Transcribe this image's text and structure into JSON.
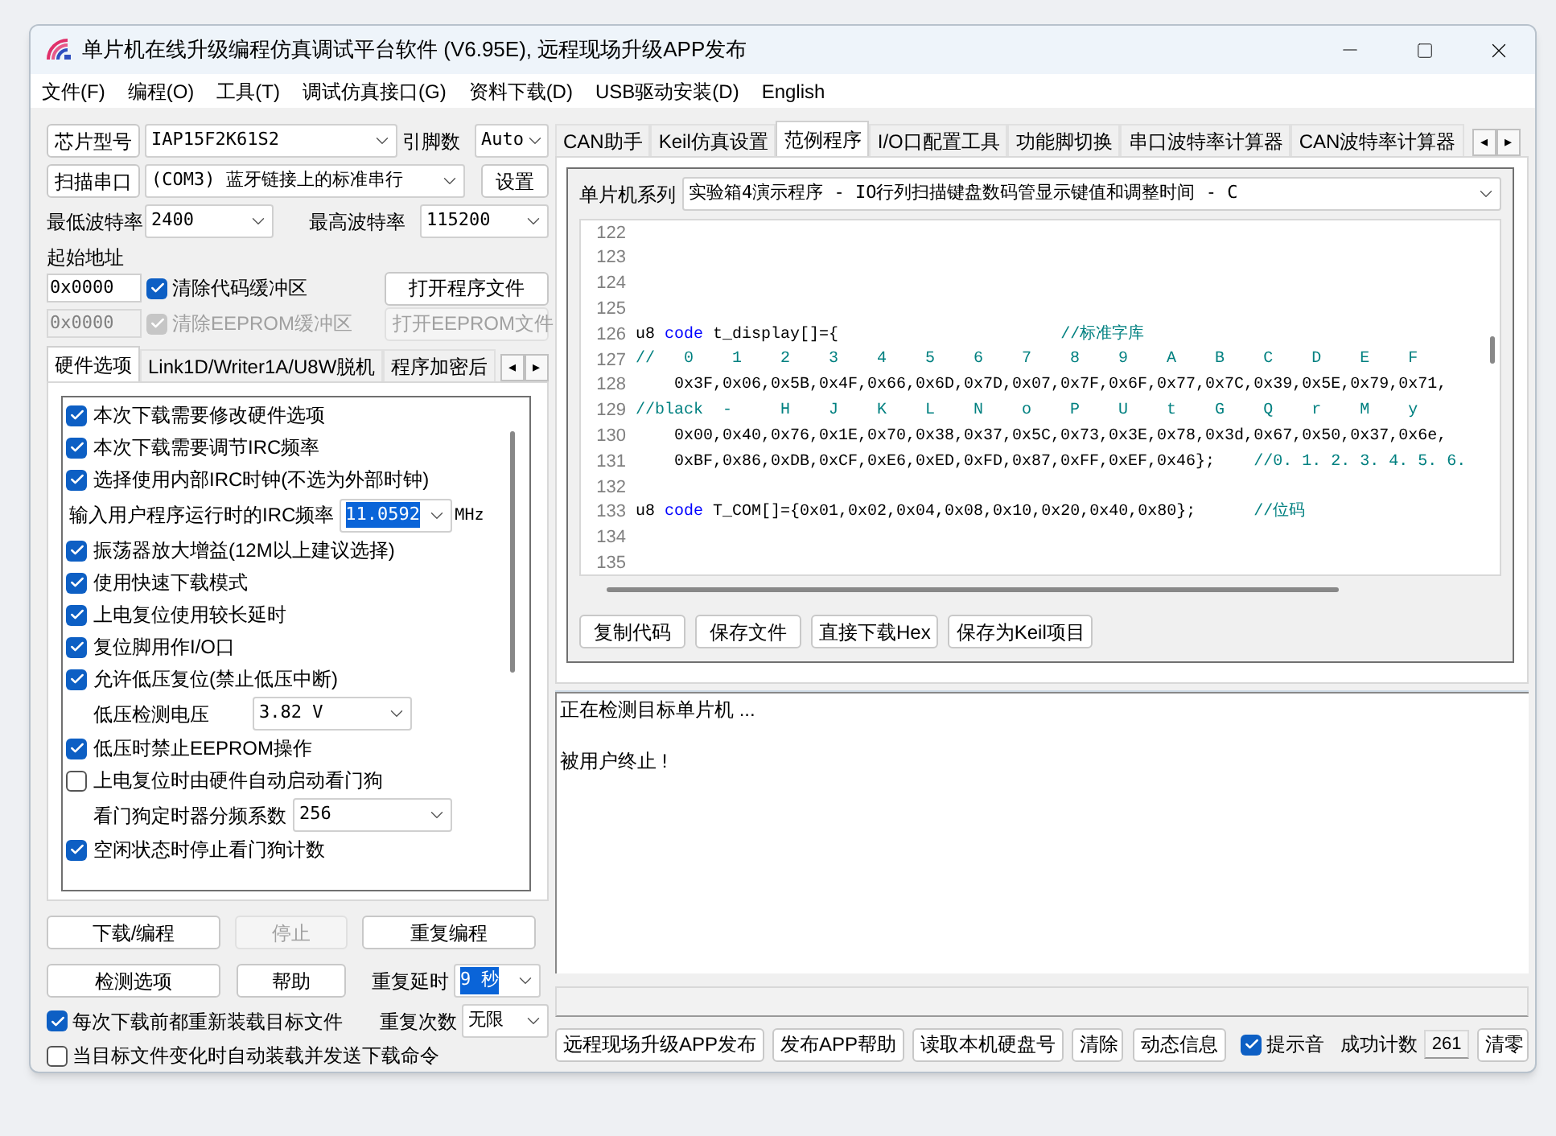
{
  "window": {
    "title": "单片机在线升级编程仿真调试平台软件 (V6.95E), 远程现场升级APP发布"
  },
  "menu": [
    "文件(F)",
    "编程(O)",
    "工具(T)",
    "调试仿真接口(G)",
    "资料下载(D)",
    "USB驱动安装(D)",
    "English"
  ],
  "chip": {
    "button": "芯片型号",
    "model": "IAP15F2K61S2",
    "pins_label": "引脚数",
    "pins": "Auto"
  },
  "port": {
    "button": "扫描串口",
    "value": "(COM3) 蓝牙链接上的标准串行",
    "settings": "设置"
  },
  "baud": {
    "min_label": "最低波特率",
    "min": "2400",
    "max_label": "最高波特率",
    "max": "115200"
  },
  "start_address": {
    "label": "起始地址",
    "value": "0x0000",
    "clear": {
      "label": "清除代码缓冲区",
      "checked": true
    },
    "open_file": "打开程序文件"
  },
  "eeprom": {
    "value": "0x0000",
    "disabled": true,
    "clear": {
      "label": "清除EEPROM缓冲区",
      "checked": true
    },
    "open_file": "打开EEPROM文件"
  },
  "left_tabs": [
    {
      "label": "硬件选项",
      "selected": true
    },
    {
      "label": "Link1D/Writer1A/U8W脱机",
      "selected": false
    },
    {
      "label": "程序加密后",
      "selected": false
    }
  ],
  "left_tab_scroll": [
    "◂",
    "▸"
  ],
  "options": [
    {
      "kind": "checkbox",
      "label": "本次下载需要修改硬件选项",
      "checked": true
    },
    {
      "kind": "checkbox",
      "label": "本次下载需要调节IRC频率",
      "checked": true
    },
    {
      "kind": "checkbox",
      "label": "选择使用内部IRC时钟(不选为外部时钟)",
      "checked": true
    },
    {
      "kind": "input",
      "label": "输入用户程序运行时的IRC频率",
      "value": "11.0592",
      "unit": "MHz"
    },
    {
      "kind": "checkbox",
      "label": "振荡器放大增益(12M以上建议选择)",
      "checked": true
    },
    {
      "kind": "checkbox",
      "label": "使用快速下载模式",
      "checked": true
    },
    {
      "kind": "checkbox",
      "label": "上电复位使用较长延时",
      "checked": true
    },
    {
      "kind": "checkbox",
      "label": "复位脚用作I/O口",
      "checked": true
    },
    {
      "kind": "checkbox",
      "label": "允许低压复位(禁止低压中断)",
      "checked": true
    },
    {
      "kind": "select",
      "label": "低压检测电压",
      "value": "3.82 V"
    },
    {
      "kind": "checkbox",
      "label": "低压时禁止EEPROM操作",
      "checked": true
    },
    {
      "kind": "checkbox",
      "label": "上电复位时由硬件自动启动看门狗",
      "checked": false
    },
    {
      "kind": "select",
      "label": "看门狗定时器分频系数",
      "value": "256"
    },
    {
      "kind": "checkbox",
      "label": "空闲状态时停止看门狗计数",
      "checked": true
    }
  ],
  "program_buttons": [
    {
      "label": "下载/编程",
      "disabled": false
    },
    {
      "label": "停止",
      "disabled": true
    },
    {
      "label": "重复编程",
      "disabled": false
    },
    {
      "label": "检测选项",
      "disabled": false
    },
    {
      "label": "帮助",
      "disabled": false
    }
  ],
  "repeat_delay": {
    "label": "重复延时",
    "value": "9 秒"
  },
  "repeat_count": {
    "label": "重复次数",
    "value": "无限"
  },
  "reload_options": [
    {
      "label": "每次下载前都重新装载目标文件",
      "checked": true
    },
    {
      "label": "当目标文件变化时自动装载并发送下载命令",
      "checked": false
    }
  ],
  "right_tabs": [
    {
      "label": "CAN助手",
      "selected": false
    },
    {
      "label": "Keil仿真设置",
      "selected": false
    },
    {
      "label": "范例程序",
      "selected": true
    },
    {
      "label": "I/O口配置工具",
      "selected": false
    },
    {
      "label": "功能脚切换",
      "selected": false
    },
    {
      "label": "串口波特率计算器",
      "selected": false
    },
    {
      "label": "CAN波特率计算器",
      "selected": false
    }
  ],
  "right_tab_scroll": [
    "◂",
    "▸"
  ],
  "examples": {
    "series_label": "单片机系列",
    "program": "实验箱4演示程序 - IO行列扫描键盘数码管显示键值和调整时间 - C",
    "code": [
      {
        "number": "122"
      },
      {
        "number": "123"
      },
      {
        "number": "124"
      },
      {
        "number": "125"
      },
      {
        "number": "126",
        "segments": [
          {
            "kind": "text",
            "text": "u8 "
          },
          {
            "kind": "keyword",
            "text": "code"
          },
          {
            "kind": "text",
            "text": " t_display[]={                       "
          },
          {
            "kind": "comment",
            "text": "//标准字库"
          }
        ]
      },
      {
        "number": "127",
        "segments": [
          {
            "kind": "comment",
            "text": "//   0    1    2    3    4    5    6    7    8    9    A    B    C    D    E    F"
          }
        ]
      },
      {
        "number": "128",
        "segments": [
          {
            "kind": "text",
            "text": "    0x3F,0x06,0x5B,0x4F,0x66,0x6D,0x7D,0x07,0x7F,0x6F,0x77,0x7C,0x39,0x5E,0x79,0x71,"
          }
        ]
      },
      {
        "number": "129",
        "segments": [
          {
            "kind": "comment",
            "text": "//black  -     H    J    K    L    N    o    P    U    t    G    Q    r    M    y"
          }
        ]
      },
      {
        "number": "130",
        "segments": [
          {
            "kind": "text",
            "text": "    0x00,0x40,0x76,0x1E,0x70,0x38,0x37,0x5C,0x73,0x3E,0x78,0x3d,0x67,0x50,0x37,0x6e,"
          }
        ]
      },
      {
        "number": "131",
        "segments": [
          {
            "kind": "text",
            "text": "    0xBF,0x86,0xDB,0xCF,0xE6,0xED,0xFD,0x87,0xFF,0xEF,0x46};    "
          },
          {
            "kind": "comment",
            "text": "//0. 1. 2. 3. 4. 5. 6."
          }
        ]
      },
      {
        "number": "132"
      },
      {
        "number": "133",
        "segments": [
          {
            "kind": "text",
            "text": "u8 "
          },
          {
            "kind": "keyword",
            "text": "code"
          },
          {
            "kind": "text",
            "text": " T_COM[]={0x01,0x02,0x04,0x08,0x10,0x20,0x40,0x80};      "
          },
          {
            "kind": "comment",
            "text": "//位码"
          }
        ]
      },
      {
        "number": "134"
      },
      {
        "number": "135"
      }
    ],
    "buttons": [
      "复制代码",
      "保存文件",
      "直接下载Hex",
      "保存为Keil项目"
    ]
  },
  "log": "正在检测目标单片机 ...\n\n被用户终止 !",
  "progress": {
    "level": 0
  },
  "bottom_buttons": [
    "远程现场升级APP发布",
    "发布APP帮助",
    "读取本机硬盘号",
    "清除",
    "动态信息"
  ],
  "sound": {
    "label": "提示音",
    "checked": true
  },
  "success": {
    "label": "成功计数",
    "value": "261",
    "reset": "清零"
  }
}
